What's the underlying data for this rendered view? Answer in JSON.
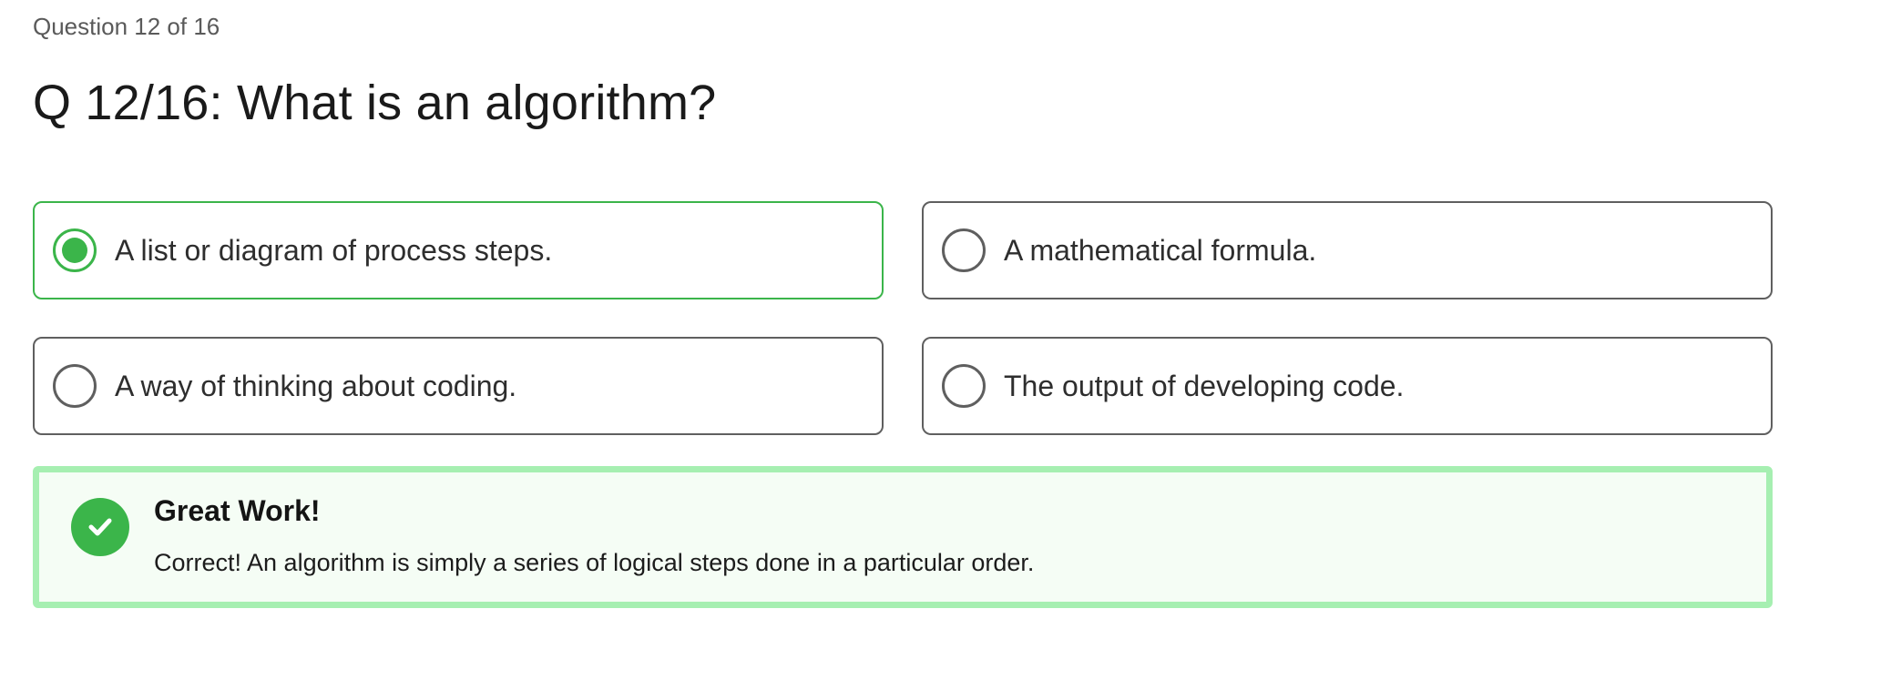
{
  "progress": {
    "label": "Question 12 of 16",
    "current": 12,
    "total": 16
  },
  "question": {
    "title": "Q 12/16: What is an algorithm?"
  },
  "options": [
    {
      "label": "A list or diagram of process steps.",
      "selected": true
    },
    {
      "label": "A mathematical formula.",
      "selected": false
    },
    {
      "label": "A way of thinking about coding.",
      "selected": false
    },
    {
      "label": "The output of developing code.",
      "selected": false
    }
  ],
  "feedback": {
    "status": "correct",
    "icon": "check-circle-icon",
    "title": "Great Work!",
    "message": "Correct! An algorithm is simply a series of logical steps done in a particular order."
  },
  "colors": {
    "correct_green": "#3bb54a",
    "feedback_border": "#a6efb1",
    "feedback_background": "#f5fdf5",
    "option_border": "#5f5f5f"
  }
}
